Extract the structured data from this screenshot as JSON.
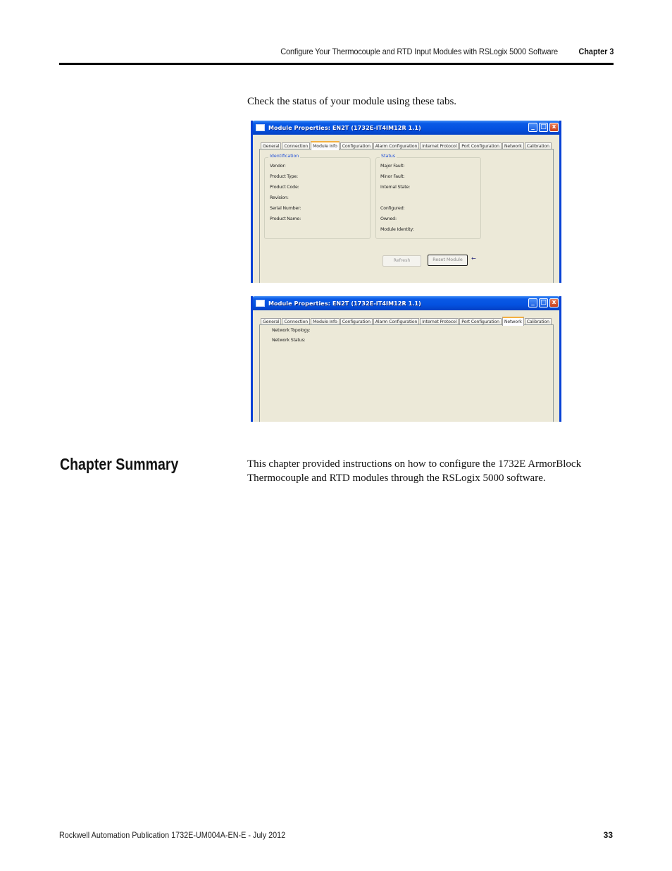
{
  "header": {
    "running_title": "Configure Your Thermocouple and RTD Input Modules with RSLogix 5000 Software",
    "chapter": "Chapter 3"
  },
  "intro": "Check the status of your module using these tabs.",
  "window_title": "Module Properties: EN2T (1732E-IT4IM12R 1.1)",
  "window_controls": {
    "minimize": "_",
    "maximize": "□",
    "close": "x"
  },
  "tabs": [
    "General",
    "Connection",
    "Module Info",
    "Configuration",
    "Alarm Configuration",
    "Internet Protocol",
    "Port Configuration",
    "Network",
    "Calibration"
  ],
  "module_info_dialog": {
    "active_tab": "Module Info",
    "identification": {
      "legend": "Identification",
      "fields": [
        "Vendor:",
        "Product Type:",
        "Product Code:",
        "Revision:",
        "Serial Number:",
        "Product Name:"
      ]
    },
    "status": {
      "legend": "Status",
      "fields": [
        "Major Fault:",
        "Minor Fault:",
        "Internal State:",
        "",
        "Configured:",
        "Owned:",
        "Module Identity:"
      ]
    },
    "buttons": {
      "refresh": "Refresh",
      "reset_module": "Reset Module"
    },
    "arrow_icon": "←"
  },
  "network_dialog": {
    "active_tab": "Network",
    "fields": [
      "Network Topology:",
      "Network Status:"
    ]
  },
  "summary": {
    "title": "Chapter Summary",
    "text": "This chapter provided instructions on how to configure the 1732E ArmorBlock Thermocouple and RTD modules through the RSLogix 5000 software."
  },
  "footer": {
    "publication": "Rockwell Automation Publication 1732E-UM004A-EN-E - July 2012",
    "page_number": "33"
  }
}
